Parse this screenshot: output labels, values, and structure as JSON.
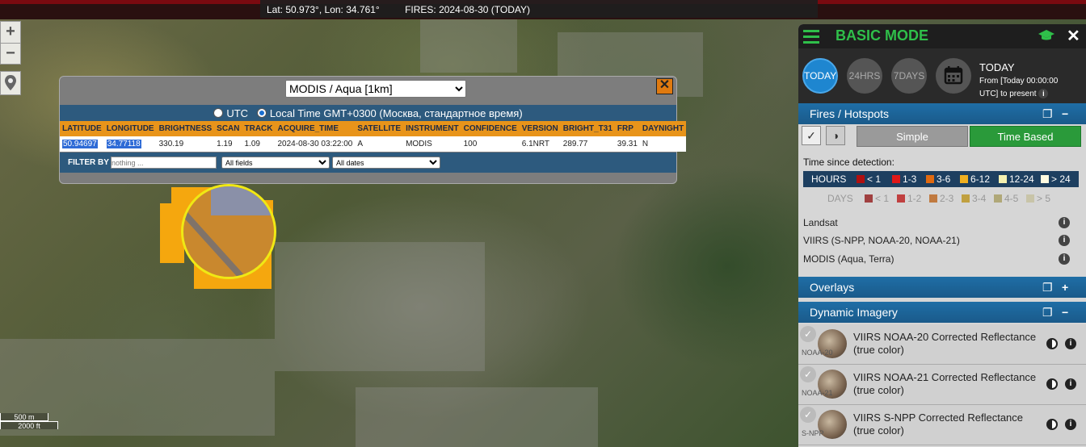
{
  "coord_bar": {
    "position": "Lat: 50.973°, Lon: 34.761°",
    "fires": "FIRES: 2024-08-30 (TODAY)"
  },
  "zoom": {
    "in": "+",
    "out": "−"
  },
  "scale": {
    "metric": "500 m",
    "imperial": "2000 ft"
  },
  "popup": {
    "satellite_select": "MODIS / Aqua [1km]",
    "close": "✕",
    "time_options": [
      "UTC",
      "Local Time GMT+0300 (Москва, стандартное время)"
    ],
    "time_selected": "Local Time GMT+0300 (Москва, стандартное время)",
    "columns": [
      "LATITUDE",
      "LONGITUDE",
      "BRIGHTNESS",
      "SCAN",
      "TRACK",
      "ACQUIRE_TIME",
      "SATELLITE",
      "INSTRUMENT",
      "CONFIDENCE",
      "VERSION",
      "BRIGHT_T31",
      "FRP",
      "DAYNIGHT"
    ],
    "row": [
      "50.94697",
      "34.77118",
      "330.19",
      "1.19",
      "1.09",
      "2024-08-30 03:22:00",
      "A",
      "MODIS",
      "100",
      "6.1NRT",
      "289.77",
      "39.31",
      "N"
    ],
    "filter_label": "FILTER BY",
    "filter_placeholder": "nothing ...",
    "fields_select": "All fields",
    "dates_select": "All dates"
  },
  "panel": {
    "mode_title": "BASIC MODE",
    "close": "✕",
    "time_buttons": [
      "TODAY",
      "24HRS",
      "7DAYS"
    ],
    "time_title": "TODAY",
    "time_sub1": "From [Today 00:00:00",
    "time_sub2": "UTC] to present",
    "fires_header": "Fires / Hotspots",
    "simple_label": "Simple",
    "time_based_label": "Time Based",
    "time_since": "Time since detection:",
    "hours_label": "HOURS",
    "hours_legend": [
      {
        "label": "< 1",
        "color": "#b01010"
      },
      {
        "label": "1-3",
        "color": "#e01818"
      },
      {
        "label": "3-6",
        "color": "#e06a10"
      },
      {
        "label": "6-12",
        "color": "#f0b020"
      },
      {
        "label": "12-24",
        "color": "#f4f0b0"
      },
      {
        "label": "> 24",
        "color": "#fffbe0"
      }
    ],
    "days_label": "DAYS",
    "days_legend": [
      {
        "label": "< 1",
        "color": "#a04040"
      },
      {
        "label": "1-2",
        "color": "#c04040"
      },
      {
        "label": "2-3",
        "color": "#c07a40"
      },
      {
        "label": "3-4",
        "color": "#c0a040"
      },
      {
        "label": "4-5",
        "color": "#b0a878"
      },
      {
        "label": "> 5",
        "color": "#c8c4a8"
      }
    ],
    "sources": [
      "Landsat",
      "VIIRS (S-NPP, NOAA-20, NOAA-21)",
      "MODIS (Aqua, Terra)"
    ],
    "overlays_header": "Overlays",
    "dynamic_header": "Dynamic Imagery",
    "layers": [
      {
        "title": "VIIRS NOAA-20 Corrected Reflectance (true color)",
        "sub": "NOAA-20"
      },
      {
        "title": "VIIRS NOAA-21 Corrected Reflectance (true color)",
        "sub": "NOAA-21"
      },
      {
        "title": "VIIRS S-NPP Corrected Reflectance (true color)",
        "sub": "S-NPP"
      }
    ]
  },
  "colors": {
    "accent_green": "#2fbf4a",
    "header_blue": "#1f6ea6",
    "fire_orange": "#f5a70e",
    "highlight_yellow": "#f0e814"
  }
}
